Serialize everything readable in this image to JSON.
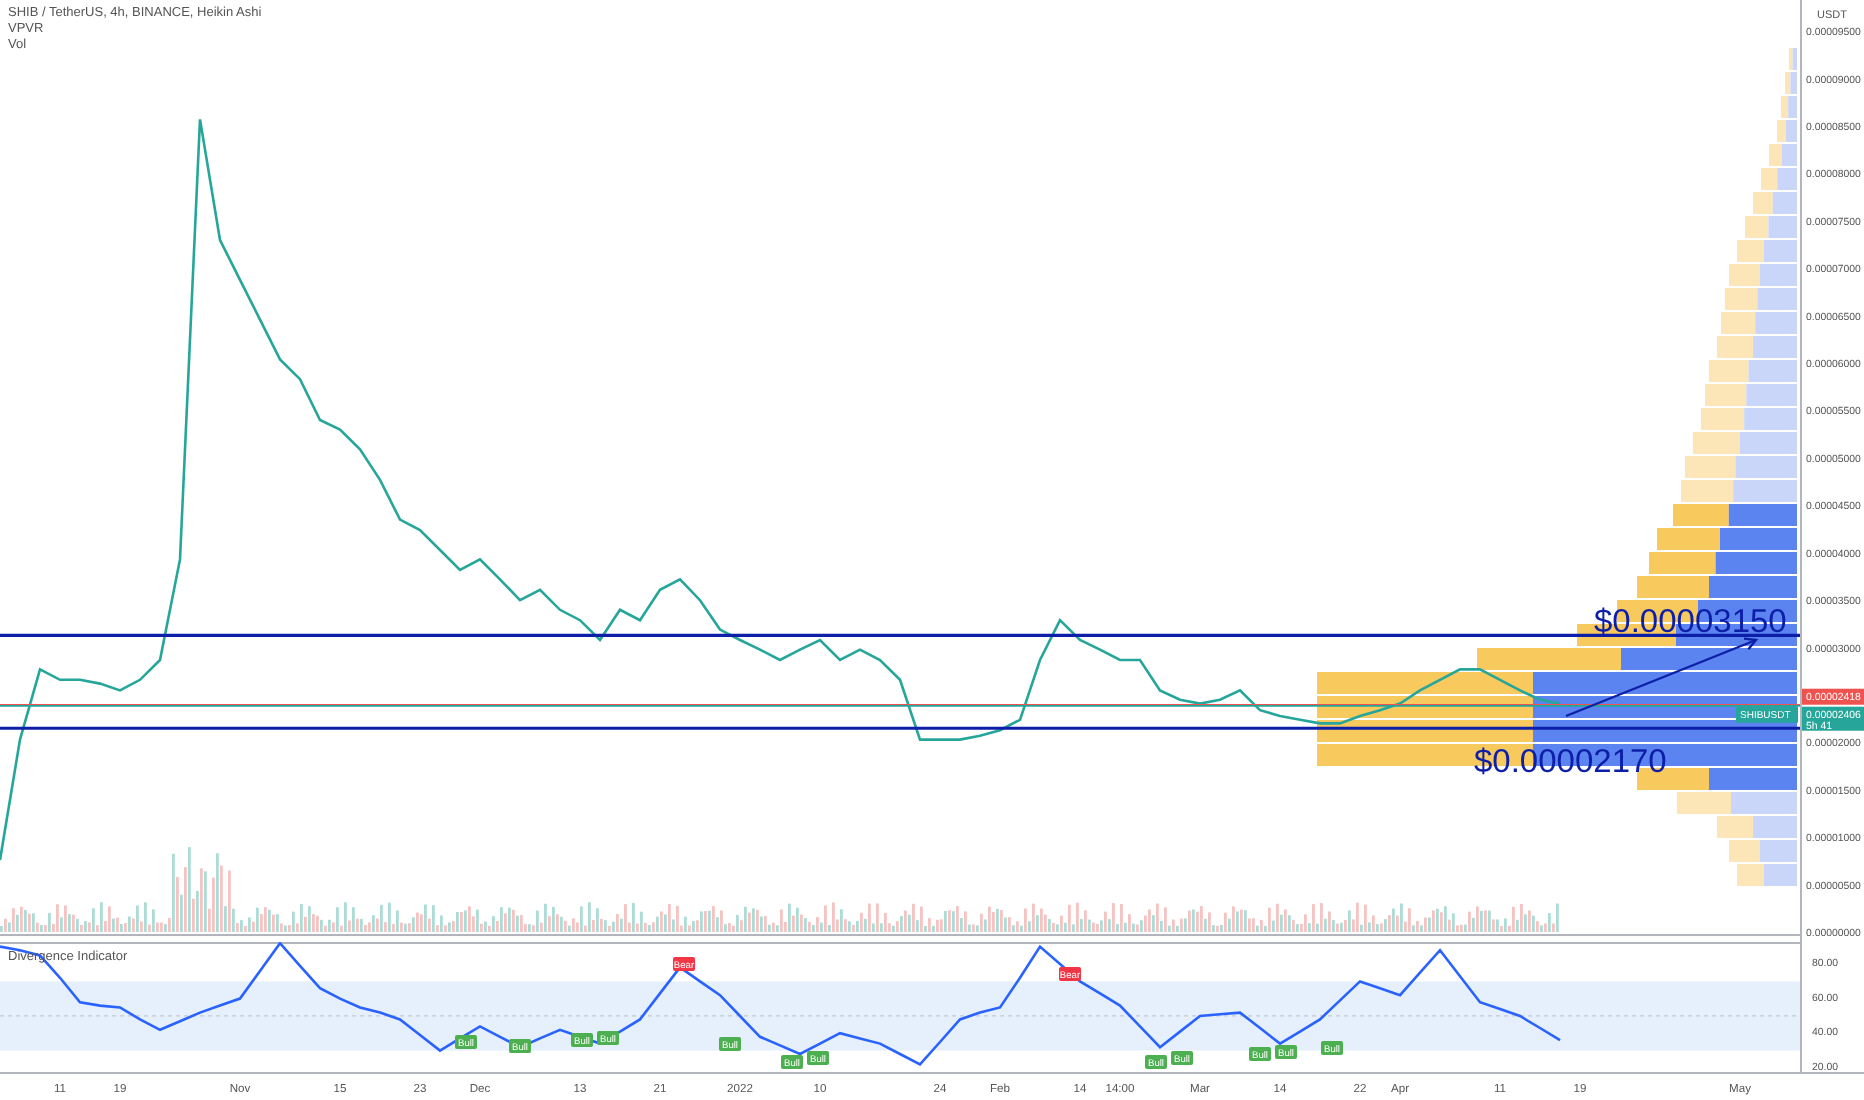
{
  "legend": {
    "title": "SHIB / TetherUS, 4h, BINANCE, Heikin Ashi",
    "lines": [
      "VPVR",
      "Vol"
    ]
  },
  "price_chart": {
    "currency": "USDT",
    "symbol_tag": "SHIBUSDT",
    "countdown": "5h 41",
    "callouts": [
      "$0.00003150",
      "$0.00002170"
    ],
    "chart_data": {
      "type": "line",
      "ylim": [
        0,
        9.85e-05
      ],
      "categories": [
        null,
        null,
        null,
        null,
        null,
        null,
        null,
        null,
        null,
        null,
        null,
        null,
        null,
        null,
        null,
        null,
        null,
        null,
        null,
        null,
        null,
        null,
        null,
        null,
        null,
        null,
        null,
        null,
        null,
        null,
        null,
        null,
        null,
        null,
        null,
        null,
        null,
        null,
        null,
        null,
        null,
        null,
        null,
        null,
        null,
        null,
        null,
        null,
        null,
        null,
        null,
        null,
        null,
        null,
        null,
        null,
        null,
        null,
        null,
        null,
        null,
        null,
        null,
        null,
        null,
        null,
        null,
        null,
        null,
        null,
        null,
        null,
        null,
        null,
        null,
        null,
        null,
        null,
        null,
        null,
        null,
        null,
        null,
        null,
        null,
        null,
        null,
        null
      ],
      "series": [
        {
          "color": "#26a69a",
          "values": [
            7.8e-06,
            2.05e-05,
            2.79e-05,
            2.68e-05,
            2.68e-05,
            2.64e-05,
            2.57e-05,
            2.68e-05,
            2.89e-05,
            3.95e-05,
            8.59e-05,
            7.32e-05,
            6.9e-05,
            6.48e-05,
            6.06e-05,
            5.85e-05,
            5.42e-05,
            5.32e-05,
            5.11e-05,
            4.79e-05,
            4.37e-05,
            4.26e-05,
            4.05e-05,
            3.84e-05,
            3.95e-05,
            3.74e-05,
            3.52e-05,
            3.63e-05,
            3.42e-05,
            3.31e-05,
            3.1e-05,
            3.42e-05,
            3.31e-05,
            3.63e-05,
            3.74e-05,
            3.52e-05,
            3.21e-05,
            3.1e-05,
            3e-05,
            2.89e-05,
            3e-05,
            3.1e-05,
            2.89e-05,
            3e-05,
            2.89e-05,
            2.68e-05,
            2.05e-05,
            2.05e-05,
            2.05e-05,
            2.09e-05,
            2.15e-05,
            2.26e-05,
            2.89e-05,
            3.31e-05,
            3.1e-05,
            3e-05,
            2.89e-05,
            2.89e-05,
            2.57e-05,
            2.47e-05,
            2.43e-05,
            2.47e-05,
            2.57e-05,
            2.36e-05,
            2.3e-05,
            2.26e-05,
            2.22e-05,
            2.22e-05,
            2.3e-05,
            2.36e-05,
            2.43e-05,
            2.57e-05,
            2.68e-05,
            2.79e-05,
            2.79e-05,
            2.68e-05,
            2.57e-05,
            2.47e-05,
            2.43e-05,
            null,
            null,
            null,
            null,
            null,
            null,
            null,
            null,
            null
          ]
        }
      ],
      "yticks": [
        {
          "value": 9.5e-05,
          "label": "0.00009500"
        },
        {
          "value": 9e-05,
          "label": "0.00009000"
        },
        {
          "value": 8.5e-05,
          "label": "0.00008500"
        },
        {
          "value": 8e-05,
          "label": "0.00008000"
        },
        {
          "value": 7.5e-05,
          "label": "0.00007500"
        },
        {
          "value": 7e-05,
          "label": "0.00007000"
        },
        {
          "value": 6.5e-05,
          "label": "0.00006500"
        },
        {
          "value": 6e-05,
          "label": "0.00006000"
        },
        {
          "value": 5.5e-05,
          "label": "0.00005500"
        },
        {
          "value": 5e-05,
          "label": "0.00005000"
        },
        {
          "value": 4.5e-05,
          "label": "0.00004500"
        },
        {
          "value": 4e-05,
          "label": "0.00004000"
        },
        {
          "value": 3.5e-05,
          "label": "0.00003500"
        },
        {
          "value": 3e-05,
          "label": "0.00003000"
        },
        {
          "value": 2e-05,
          "label": "0.00002000"
        },
        {
          "value": 1.5e-05,
          "label": "0.00001500"
        },
        {
          "value": 1e-05,
          "label": "0.00001000"
        },
        {
          "value": 5e-06,
          "label": "0.00000500"
        },
        {
          "value": 0,
          "label": "0.00000000"
        }
      ],
      "ref_lines": [
        {
          "axis": "y",
          "value": 3.15e-05,
          "color": "#0d1fa8"
        },
        {
          "axis": "y",
          "value": 2.17e-05,
          "color": "#0d1fa8"
        },
        {
          "axis": "y",
          "value": 2.418e-05,
          "color": "#ef5350",
          "label": "0.00002418"
        },
        {
          "axis": "y",
          "value": 2.406e-05,
          "color": "#26a69a",
          "label": "0.00002406"
        }
      ]
    }
  },
  "indicator": {
    "title": "Divergence Indicator",
    "signals": [
      {
        "kind": "bear",
        "text": "Bear"
      },
      {
        "kind": "bear",
        "text": "Bear"
      },
      {
        "kind": "bull",
        "text": "Bull"
      },
      {
        "kind": "bull",
        "text": "Bull"
      },
      {
        "kind": "bull",
        "text": "Bull"
      },
      {
        "kind": "bull",
        "text": "Bull"
      },
      {
        "kind": "bull",
        "text": "Bull"
      },
      {
        "kind": "bull",
        "text": "Bull"
      },
      {
        "kind": "bull",
        "text": "Bull"
      },
      {
        "kind": "bull",
        "text": "Bull"
      },
      {
        "kind": "bull",
        "text": "Bull"
      },
      {
        "kind": "bull",
        "text": "Bull"
      },
      {
        "kind": "bull",
        "text": "Bull"
      },
      {
        "kind": "bull",
        "text": "Bull"
      }
    ],
    "chart_data": {
      "type": "line",
      "ylim": [
        16.5,
        92.7
      ],
      "categories": [
        null,
        null,
        null,
        "11",
        null,
        null,
        "19",
        null,
        null,
        null,
        null,
        null,
        "Nov",
        null,
        null,
        null,
        null,
        "15",
        null,
        null,
        null,
        "23",
        null,
        null,
        "Dec",
        null,
        null,
        null,
        null,
        "13",
        null,
        null,
        null,
        "21",
        null,
        null,
        null,
        "2022",
        null,
        null,
        null,
        "10",
        null,
        null,
        null,
        null,
        null,
        "24",
        null,
        null,
        "Feb",
        null,
        null,
        null,
        "14",
        null,
        "14:00",
        null,
        null,
        null,
        "Mar",
        null,
        null,
        null,
        "14",
        null,
        null,
        null,
        "22",
        null,
        "Apr",
        null,
        null,
        null,
        null,
        "11",
        null,
        null,
        null,
        "19",
        null,
        null,
        null,
        null,
        null,
        null,
        null,
        "May"
      ],
      "series": [
        {
          "color": "#2962ff",
          "values": [
            90,
            88,
            85,
            72,
            58,
            56,
            55,
            48,
            42,
            47,
            52,
            56,
            60,
            76,
            92,
            79,
            66,
            60,
            55,
            52,
            48,
            39,
            30,
            37,
            44,
            38,
            32,
            37,
            42,
            38,
            34,
            41,
            48,
            63,
            78,
            70,
            62,
            50,
            38,
            33,
            28,
            34,
            40,
            37,
            34,
            28,
            22,
            35,
            48,
            52,
            55,
            72,
            90,
            80,
            70,
            63,
            56,
            44,
            32,
            41,
            50,
            51,
            52,
            43,
            34,
            41,
            48,
            59,
            70,
            66,
            62,
            75,
            88,
            73,
            58,
            54,
            50,
            43,
            36,
            null,
            null,
            null,
            null,
            null,
            null,
            null,
            null,
            null
          ]
        }
      ],
      "ref_lines": [
        {
          "axis": "y",
          "value": 50,
          "color": "#c3c7d0"
        }
      ],
      "yticks": [
        {
          "value": 80,
          "label": "80.00"
        },
        {
          "value": 60,
          "label": "60.00"
        },
        {
          "value": 40,
          "label": "40.00"
        },
        {
          "value": 20,
          "label": "20.00"
        }
      ],
      "bands": [
        {
          "axis": "y",
          "from": 30,
          "to": 70,
          "color": "#e6f0fd"
        }
      ]
    }
  }
}
